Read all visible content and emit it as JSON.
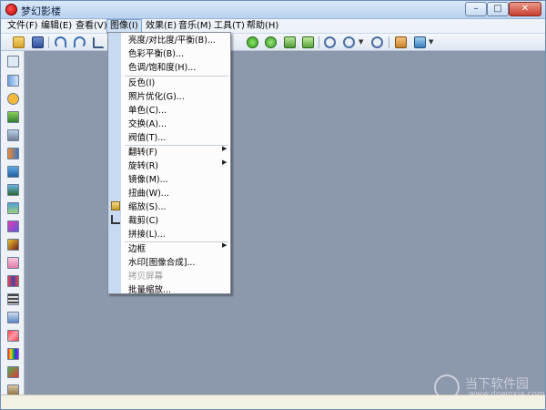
{
  "window": {
    "title": "梦幻影楼",
    "controls": {
      "minimize": "–",
      "maximize": "□",
      "close": "✕"
    }
  },
  "menubar": {
    "items": [
      {
        "label": "文件(F)"
      },
      {
        "label": "编辑(E)"
      },
      {
        "label": "查看(V)"
      },
      {
        "label": "图像(I)",
        "active": true
      },
      {
        "label": "效果(E)"
      },
      {
        "label": "音乐(M)"
      },
      {
        "label": "工具(T)"
      },
      {
        "label": "帮助(H)"
      }
    ]
  },
  "toolbar": {
    "icons": [
      "open-icon",
      "save-icon",
      "undo-icon",
      "redo-icon",
      "crop-icon",
      "play-icon",
      "record-icon",
      "image-in-icon",
      "image-out-icon",
      "zoom-in-icon",
      "zoom-out-icon",
      "home-icon",
      "screen-icon"
    ],
    "colors": {
      "face": "#eef3fa",
      "accent": "#3d6fb0"
    }
  },
  "image_menu": {
    "items": [
      {
        "label": "亮度/对比度/平衡(B)..."
      },
      {
        "label": "色彩平衡(B)..."
      },
      {
        "label": "色调/饱和度(H)..."
      },
      {
        "label": "反色(I)"
      },
      {
        "label": "照片优化(G)..."
      },
      {
        "label": "单色(C)..."
      },
      {
        "label": "交换(A)..."
      },
      {
        "label": "阀值(T)..."
      },
      {
        "label": "翻转(F)",
        "submenu": true
      },
      {
        "label": "旋转(R)",
        "submenu": true
      },
      {
        "label": "镜像(M)..."
      },
      {
        "label": "扭曲(W)..."
      },
      {
        "label": "缩放(S)...",
        "icon": "resize-icon"
      },
      {
        "label": "裁剪(C)",
        "icon": "crop-icon"
      },
      {
        "label": "拼接(L)..."
      },
      {
        "label": "边框",
        "submenu": true
      },
      {
        "label": "水印[图像合成]..."
      },
      {
        "label": "拷贝屏幕",
        "disabled": true
      },
      {
        "label": "批量缩放..."
      }
    ]
  },
  "left_toolbar": {
    "icons": [
      "pointer-icon",
      "move-icon",
      "face-icon",
      "landscape-icon",
      "people-icon",
      "move-right-icon",
      "picture-icon",
      "frame-icon",
      "fill-icon",
      "wave-icon",
      "flower-icon",
      "envelope-icon",
      "chart-icon",
      "film-icon",
      "triangle-icon",
      "star-icon",
      "rainbow-icon",
      "photo-icon",
      "lock-icon"
    ]
  },
  "watermark": {
    "name": "当下软件园",
    "url": "www.downxia.com"
  },
  "colors": {
    "workspace": "#8c98ac",
    "gutter": "#c7daf1",
    "active_menu": "#cfe0f5",
    "close": "#c84030"
  }
}
